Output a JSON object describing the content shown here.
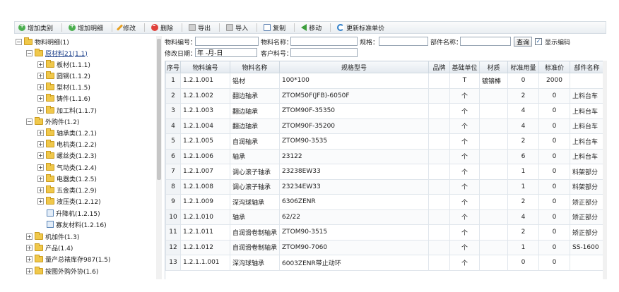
{
  "toolbar": {
    "add_category": "增加类别",
    "add_detail": "增加明细",
    "edit": "修改",
    "delete": "删除",
    "export": "导出",
    "import": "导入",
    "copy": "复制",
    "move": "移动",
    "update_price": "更新标准单价"
  },
  "tree": {
    "root": "物料明细(1)",
    "n_raw": "原材料21(1.1)",
    "n_plate": "板材(1.1.1)",
    "n_round": "圆钢(1.1.2)",
    "n_profile": "型材(1.1.5)",
    "n_cast": "铸件(1.1.6)",
    "n_process": "加工料(1.1.7)",
    "n_outsource": "外购件(1.2)",
    "n_bearing": "轴承类(1.2.1)",
    "n_motor": "电机类(1.2.2)",
    "n_bolt": "螺丝类(1.2.3)",
    "n_pneu": "气动类(1.2.4)",
    "n_elec": "电器类(1.2.5)",
    "n_hardware": "五金类(1.2.9)",
    "n_hydraulic": "液压类(1.2.12)",
    "n_elevator": "升降机(1.2.15)",
    "n_deposit": "寡友材料(1.2.16)",
    "n_machined": "机加件(1.3)",
    "n_product": "产品(1.4)",
    "n_stock": "量产总裱库存987(1.5)",
    "n_outsrc_proc": "按图外购外协(1.6)"
  },
  "form": {
    "code_label": "物料编号：",
    "code_value": "",
    "name_label": "物料名称：",
    "name_value": "",
    "spec_label": "规格：",
    "spec_value": "",
    "part_label": "部件名称：",
    "part_value": "",
    "query_button": "查询",
    "show_code_label": "显示编码",
    "show_code_checked": "✓",
    "date_label": "修改日期：",
    "date_value": "年 -月-日",
    "customer_label": "客户料号：",
    "customer_value": ""
  },
  "table": {
    "columns": [
      "序号",
      "物料编号",
      "物料名称",
      "规格型号",
      "品牌",
      "基础单位",
      "材质",
      "标准用量",
      "标准价",
      "部件名称"
    ],
    "rows": [
      [
        "1",
        "1.2.1.001",
        "铝材",
        "100*100",
        "",
        "T",
        "镀铬棒",
        "0",
        "2000",
        ""
      ],
      [
        "2",
        "1.2.1.002",
        "翻边轴承",
        "ZTOM50F(JFB)-6050F",
        "",
        "个",
        "",
        "2",
        "0",
        "上料台车"
      ],
      [
        "3",
        "1.2.1.003",
        "翻边轴承",
        "ZTOM90F-35350",
        "",
        "个",
        "",
        "4",
        "0",
        "上料台车"
      ],
      [
        "4",
        "1.2.1.004",
        "翻边轴承",
        "ZTOM90F-35200",
        "",
        "个",
        "",
        "4",
        "0",
        "上料台车"
      ],
      [
        "5",
        "1.2.1.005",
        "自润轴承",
        "ZTOM90-3535",
        "",
        "个",
        "",
        "2",
        "0",
        "上料台车"
      ],
      [
        "6",
        "1.2.1.006",
        "轴承",
        "23122",
        "",
        "个",
        "",
        "6",
        "0",
        "上料台车"
      ],
      [
        "7",
        "1.2.1.007",
        "调心滚子轴承",
        "23238EW33",
        "",
        "个",
        "",
        "1",
        "0",
        "料架部分"
      ],
      [
        "8",
        "1.2.1.008",
        "调心滚子轴承",
        "23234EW33",
        "",
        "个",
        "",
        "1",
        "0",
        "料架部分"
      ],
      [
        "9",
        "1.2.1.009",
        "深沟球轴承",
        "6306ZENR",
        "",
        "个",
        "",
        "2",
        "0",
        "矫正部分"
      ],
      [
        "10",
        "1.2.1.010",
        "轴承",
        "62/22",
        "",
        "个",
        "",
        "4",
        "0",
        "矫正部分"
      ],
      [
        "11",
        "1.2.1.011",
        "自润滑卷制轴承",
        "ZTOM90-3515",
        "",
        "个",
        "",
        "2",
        "0",
        "矫正部分"
      ],
      [
        "12",
        "1.2.1.012",
        "自润滑卷制轴承",
        "ZTOM90-7060",
        "",
        "个",
        "",
        "1",
        "0",
        "SS-1600"
      ],
      [
        "13",
        "1.2.1.1.001",
        "深沟球轴承",
        "6003ZENR带止动环",
        "",
        "个",
        "",
        "0",
        "0",
        ""
      ]
    ]
  }
}
